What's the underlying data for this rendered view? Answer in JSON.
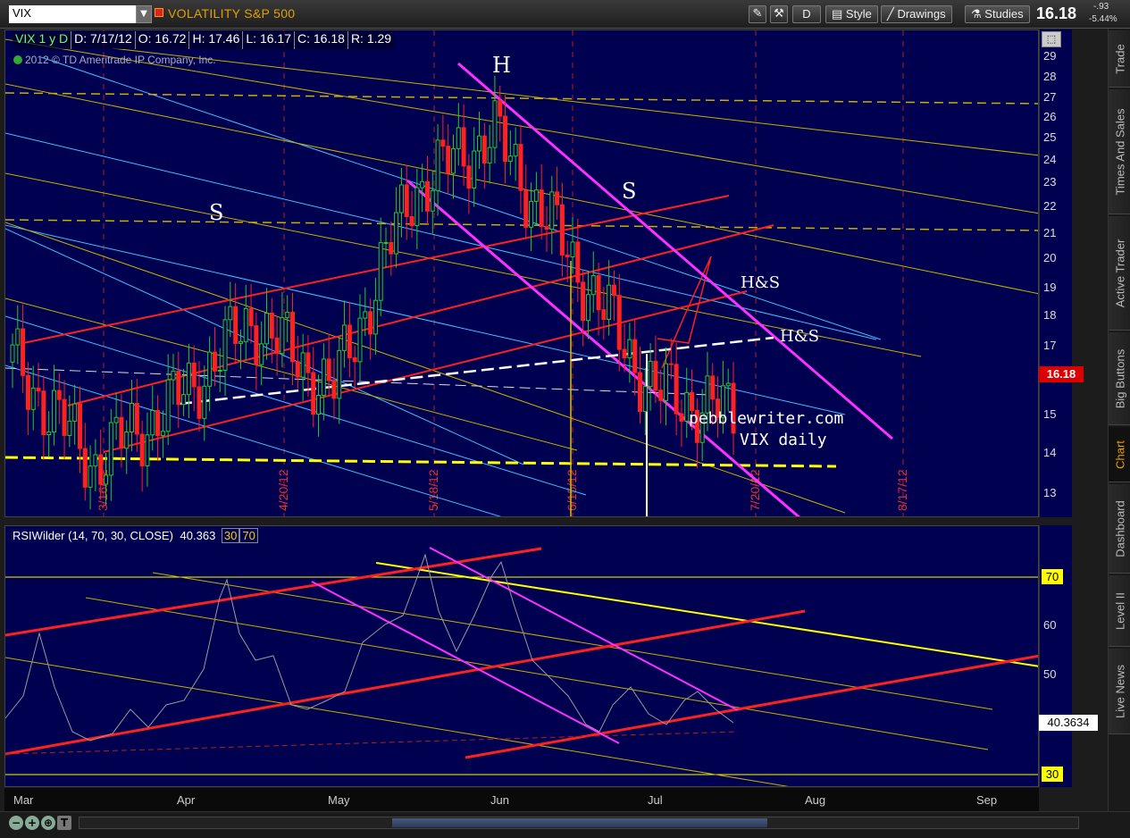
{
  "toolbar": {
    "symbol": "VIX",
    "title": "VOLATILITY S&P 500",
    "d_button": "D",
    "style_label": "Style",
    "drawings_label": "Drawings",
    "studies_label": "Studies",
    "last_price": "16.18",
    "change": "-.93",
    "change_pct": "-5.44%"
  },
  "price_pane": {
    "legend": {
      "symbol_period": "VIX 1 y D",
      "date": "D: 7/17/12",
      "open": "O: 16.72",
      "high": "H: 17.46",
      "low": "L: 16.17",
      "close": "C: 16.18",
      "range": "R: 1.29"
    },
    "copyright": "2012 © TD Ameritrade IP Company, Inc.",
    "y_ticks": [
      "29",
      "28",
      "27",
      "26",
      "25",
      "24",
      "23",
      "22",
      "21",
      "20",
      "19",
      "18",
      "17",
      "16",
      "15",
      "14",
      "13"
    ],
    "price_tag": "16.18",
    "annotations": {
      "h": "H",
      "s_left": "S",
      "s_right": "S",
      "hs_upper": "H&S",
      "hs_lower": "H&S",
      "watermark_1": "pebblewriter.com",
      "watermark_2": "VIX daily"
    },
    "date_markers": [
      "3/16/12",
      "4/20/12",
      "5/18/12",
      "6/15/12",
      "7/20/12",
      "8/17/12"
    ],
    "colors": {
      "background": "#000050",
      "red": "#ff2020",
      "yellow": "#ffff00",
      "magenta": "#ff30ff",
      "cyan": "#40c0ff",
      "gold": "#d4b400"
    }
  },
  "rsi_pane": {
    "legend": "RSIWilder (14, 70, 30, CLOSE)",
    "value": "40.363",
    "ob": "30",
    "os": "70",
    "y_ticks": [
      "70",
      "60",
      "50",
      "40",
      "30"
    ],
    "rsi_tag": "40.3634"
  },
  "x_axis": [
    "Mar",
    "Apr",
    "May",
    "Jun",
    "Jul",
    "Aug",
    "Sep"
  ],
  "sidebar": [
    "Trade",
    "Times And Sales",
    "Active Trader",
    "Big Buttons",
    "Chart",
    "Dashboard",
    "Level II",
    "Live News"
  ],
  "chart_data": {
    "type": "candlestick",
    "x": [
      "2012-03-01",
      "2012-03-16",
      "2012-04-02",
      "2012-04-20",
      "2012-05-01",
      "2012-05-18",
      "2012-06-01",
      "2012-06-15",
      "2012-07-02",
      "2012-07-17"
    ],
    "close": [
      18.0,
      14.5,
      16.5,
      19.5,
      17.0,
      24.0,
      26.0,
      21.5,
      17.0,
      16.18
    ],
    "ylim": [
      12.5,
      29.5
    ]
  }
}
